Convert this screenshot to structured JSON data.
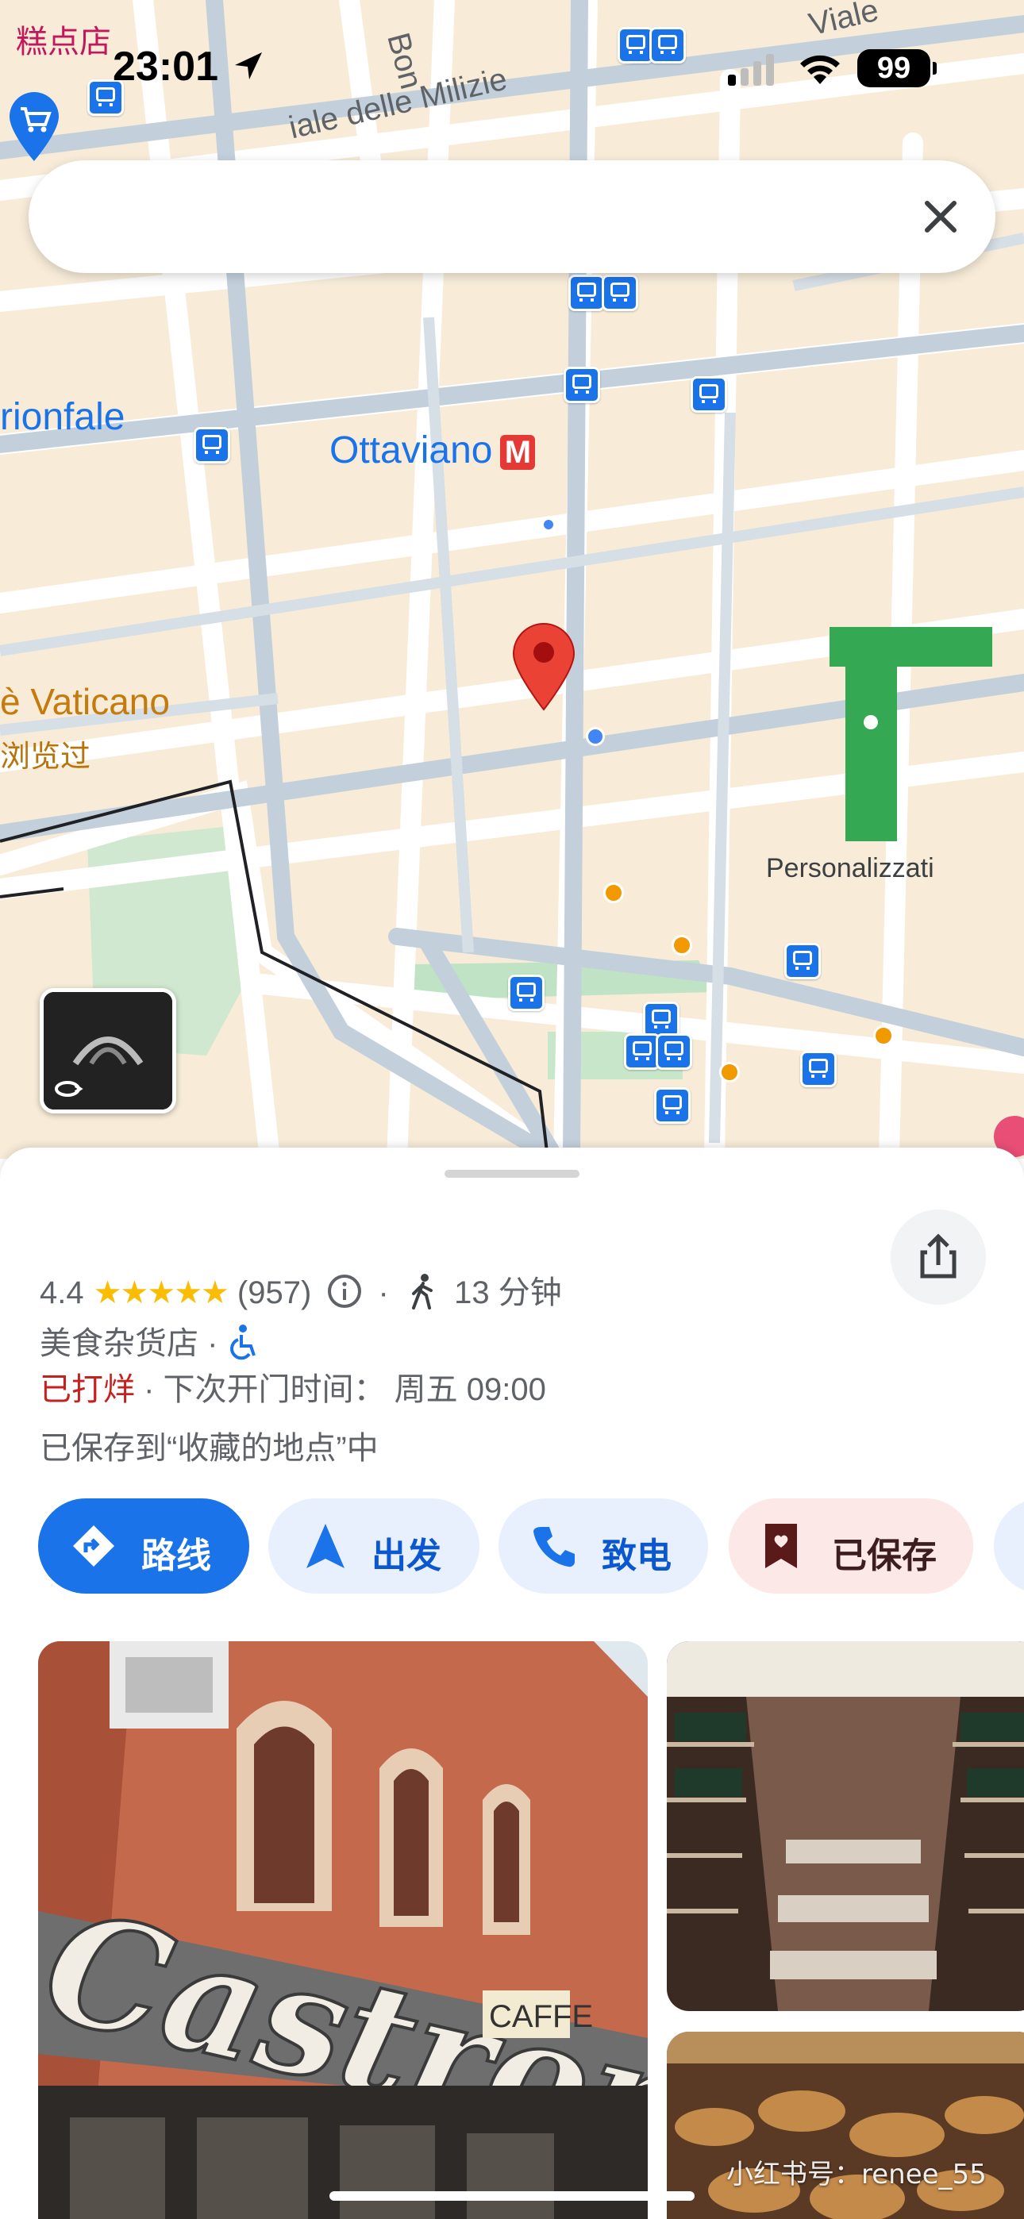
{
  "status": {
    "time": "23:01",
    "battery": "99",
    "corner_tag": "糕点店"
  },
  "map": {
    "streets": [
      "iale delle Milizie",
      "Bon",
      "Viale"
    ],
    "poi_labels": {
      "trionfale": "rionfale",
      "ottaviano": "Ottaviano",
      "metro_letter": "M",
      "vaticano": "è Vaticano",
      "vaticano_sub": "浏览过",
      "personalizzati": "Personalizzati"
    }
  },
  "place": {
    "rating": "4.4",
    "stars": "★★★★★",
    "review_count": "(957)",
    "walk_time": "13 分钟",
    "category": "美食杂货店",
    "status_closed": "已打烊",
    "next_open": "下次开门时间： 周五 09:00",
    "saved_note": "已保存到“收藏的地点”中"
  },
  "actions": {
    "route": "路线",
    "start": "出发",
    "call": "致电",
    "saved": "已保存"
  },
  "photos": {
    "storefront_sign": "Castroni",
    "caffe": "CAFFE"
  },
  "watermark": "小红书号：renee_55",
  "colors": {
    "primary": "#1a73e8",
    "chip_bg": "#e8f0fe",
    "saved_bg": "#fce8e6",
    "closed_red": "#c5221f",
    "star": "#fbbc04"
  }
}
